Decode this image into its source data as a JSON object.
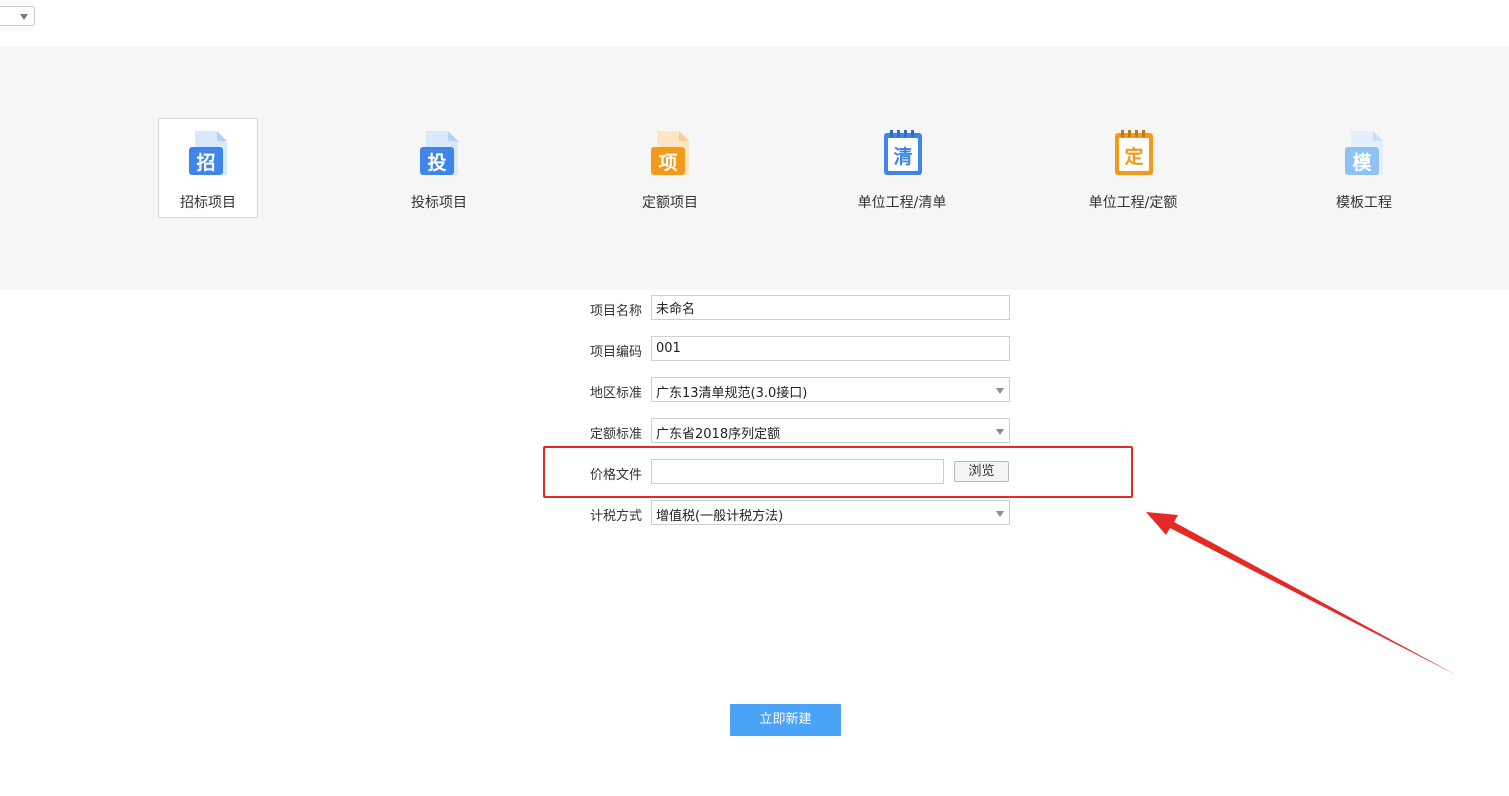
{
  "project_types": [
    {
      "key": "zhao",
      "label": "招标项目",
      "glyph": "招",
      "icon": "tender-project-icon",
      "color": "#3f86e8",
      "active": true
    },
    {
      "key": "tou",
      "label": "投标项目",
      "glyph": "投",
      "icon": "bid-project-icon",
      "color": "#3f86e8",
      "active": false
    },
    {
      "key": "xiang",
      "label": "定额项目",
      "glyph": "项",
      "icon": "quota-project-icon",
      "color": "#f39a1b",
      "active": false
    },
    {
      "key": "qing",
      "label": "单位工程/清单",
      "glyph": "清",
      "icon": "unit-bill-icon",
      "color": "#3f86e8",
      "active": false
    },
    {
      "key": "ding",
      "label": "单位工程/定额",
      "glyph": "定",
      "icon": "unit-quota-icon",
      "color": "#f39a1b",
      "active": false
    },
    {
      "key": "mo",
      "label": "模板工程",
      "glyph": "模",
      "icon": "template-project-icon",
      "color": "#8fc1f5",
      "active": false
    }
  ],
  "form": {
    "project_name": {
      "label": "项目名称",
      "value": "未命名"
    },
    "project_code": {
      "label": "项目编码",
      "value": "001"
    },
    "region_standard": {
      "label": "地区标准",
      "value": "广东13清单规范(3.0接口)"
    },
    "quota_standard": {
      "label": "定额标准",
      "value": "广东省2018序列定额"
    },
    "price_file": {
      "label": "价格文件",
      "value": "",
      "browse_label": "浏览"
    },
    "tax_method": {
      "label": "计税方式",
      "value": "增值税(一般计税方法)"
    }
  },
  "create_button": {
    "label": "立即新建"
  },
  "colors": {
    "accent": "#4ba3f7",
    "annotation": "#e52a26",
    "band": "#f6f6f6"
  }
}
